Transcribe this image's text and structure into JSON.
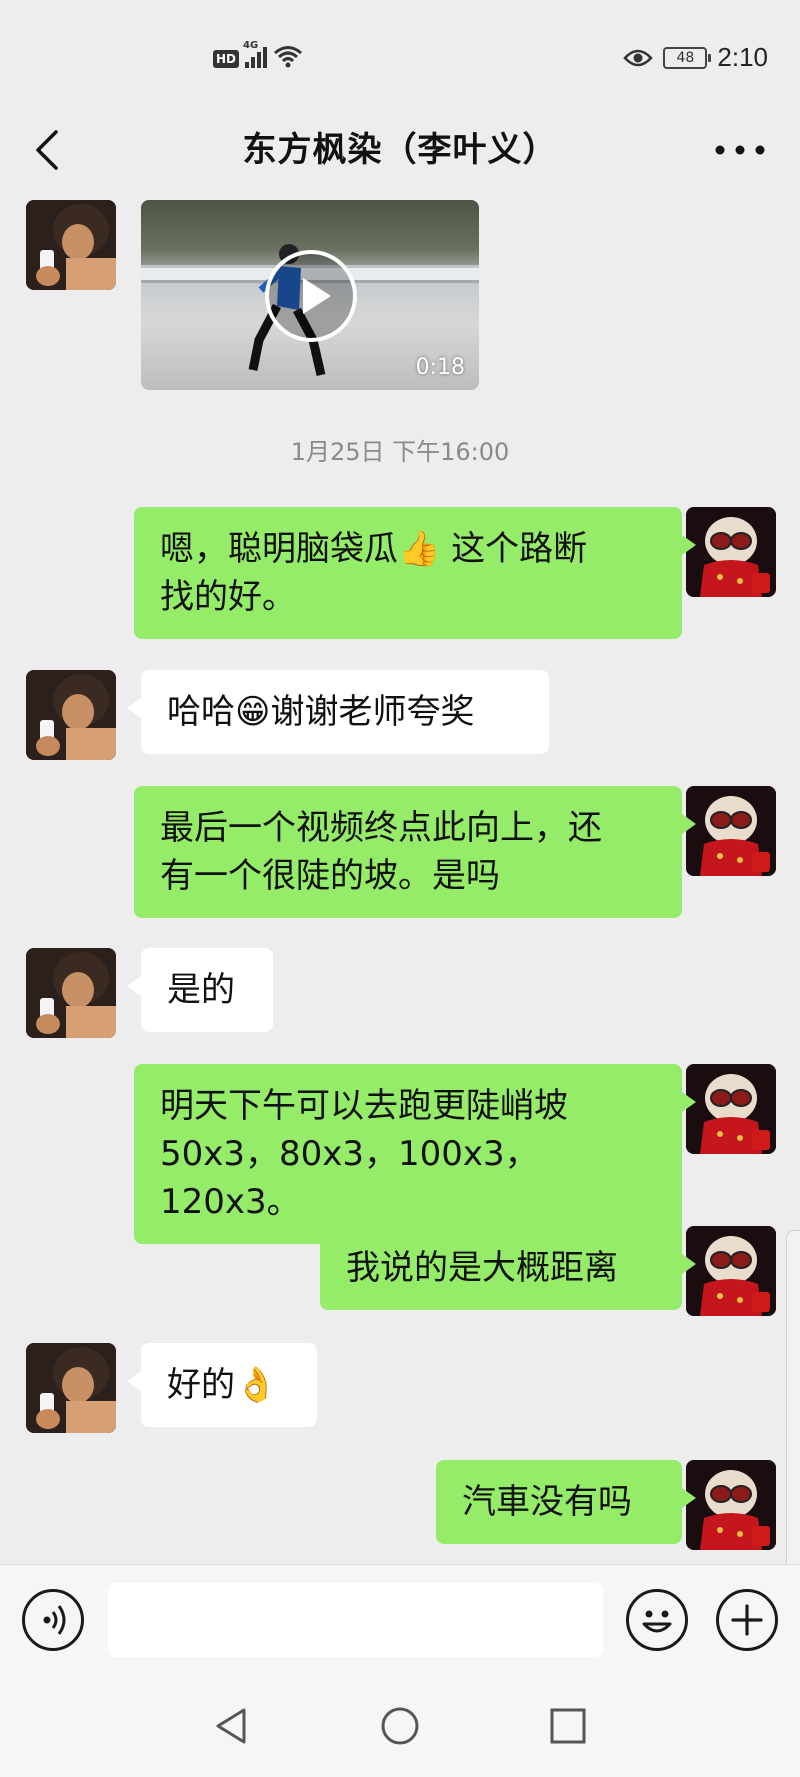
{
  "status_bar": {
    "hd": "HD",
    "network": "4G",
    "battery": "48",
    "time": "2:10"
  },
  "header": {
    "title": "东方枫染（李叶义）"
  },
  "video": {
    "duration": "0:18"
  },
  "timestamp": "1月25日 下午16:00",
  "messages": [
    {
      "from": "me",
      "lines": [
        "嗯，聪明脑袋瓜👍 这个路断",
        "找的好。"
      ]
    },
    {
      "from": "other",
      "lines": [
        "哈哈😁谢谢老师夸奖"
      ]
    },
    {
      "from": "me",
      "lines": [
        "最后一个视频终点此向上，还",
        "有一个很陡的坡。是吗"
      ]
    },
    {
      "from": "other",
      "lines": [
        "是的"
      ]
    },
    {
      "from": "me",
      "lines": [
        "明天下午可以去跑更陡峭坡",
        "50x3，80x3，100x3，120x3。"
      ]
    },
    {
      "from": "me",
      "lines": [
        "我说的是大概距离"
      ]
    },
    {
      "from": "other",
      "lines": [
        "好的👌"
      ]
    },
    {
      "from": "me",
      "lines": [
        "汽車没有吗"
      ]
    }
  ],
  "input": {
    "value": "",
    "placeholder": ""
  },
  "icons": {
    "back": "chevron-left-icon",
    "more": "more-dots-icon",
    "voice": "voice-icon",
    "emoji": "emoji-icon",
    "plus": "plus-icon",
    "eye": "eye-icon",
    "wifi": "wifi-icon"
  },
  "colors": {
    "my_bubble": "#95ec69",
    "other_bubble": "#ffffff",
    "background": "#ededed"
  }
}
